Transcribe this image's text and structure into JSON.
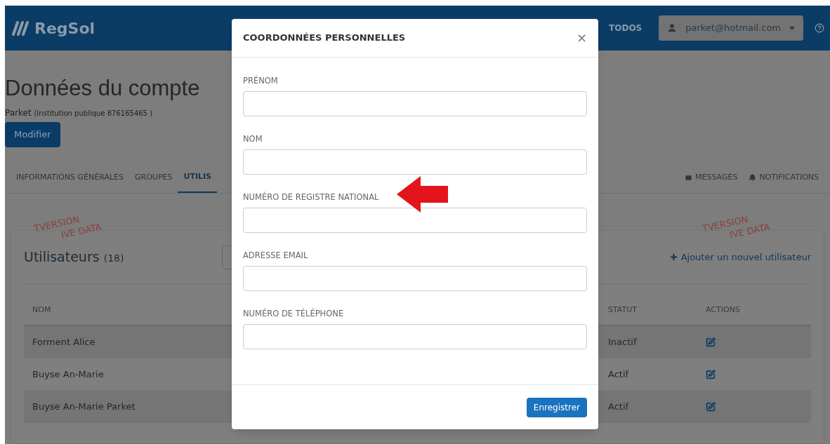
{
  "header": {
    "logo": "RegSol",
    "nav_item": "TODOS",
    "user": "parket@hotmail.com"
  },
  "account": {
    "title": "Données du compte",
    "name": "Parket",
    "detail": "(Institution publique 876165465 )",
    "edit_button": "Modifier"
  },
  "tabs": [
    {
      "label": "INFORMATIONS GÉNÉRALES",
      "selected": false
    },
    {
      "label": "GROUPES",
      "selected": false
    },
    {
      "label": "UTILIS",
      "selected": true
    }
  ],
  "right_tabs": [
    {
      "kind": "mail",
      "label": "MESSAGES"
    },
    {
      "kind": "bell",
      "label": "NOTIFICATIONS"
    }
  ],
  "stamps": [
    {
      "lines": [
        "TVERSION",
        "IVE DATA"
      ]
    },
    {
      "lines": [
        "TVERSION",
        "IVE DATA"
      ]
    }
  ],
  "users": {
    "title": "Utilisateurs",
    "count": "(18)",
    "add_link": "Ajouter un nouvel utilisateur",
    "columns": [
      "NOM",
      "STATUT",
      "ACTIONS"
    ],
    "rows": [
      {
        "name": "Forment Alice",
        "status": "Inactif"
      },
      {
        "name": "Buyse An-Marie",
        "status": "Actif"
      },
      {
        "name": "Buyse An-Marie Parket",
        "status": "Actif"
      }
    ]
  },
  "modal": {
    "title": "COORDONNÉES PERSONNELLES",
    "close": "×",
    "fields": [
      {
        "label": "PRÉNOM"
      },
      {
        "label": "NOM"
      },
      {
        "label": "NUMÉRO DE REGISTRE NATIONAL"
      },
      {
        "label": "ADRESSE EMAIL"
      },
      {
        "label": "NUMÉRO DE TÉLÉPHONE"
      }
    ],
    "save_button": "Enregistrer"
  }
}
